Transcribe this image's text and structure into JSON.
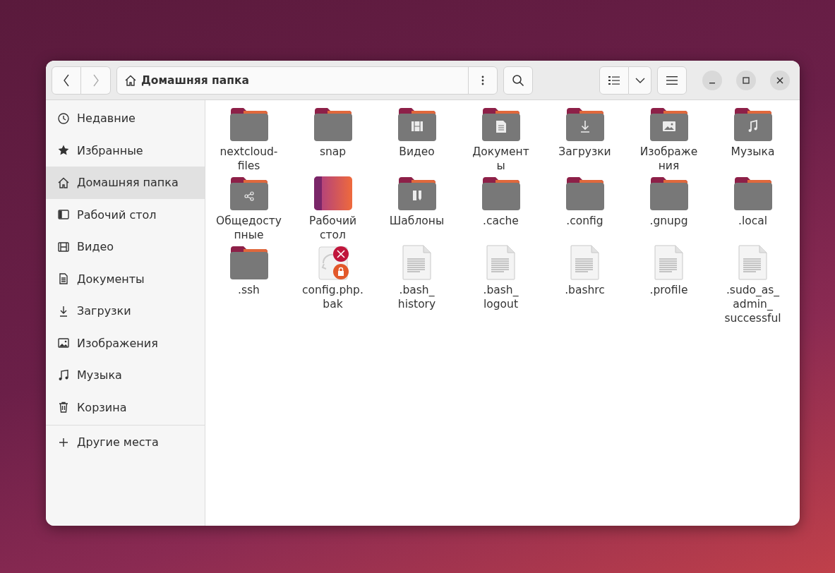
{
  "window": {
    "title": "Домашняя папка"
  },
  "sidebar": {
    "items": [
      {
        "kind": "recent",
        "label": "Недавние",
        "selected": false
      },
      {
        "kind": "starred",
        "label": "Избранные",
        "selected": false
      },
      {
        "kind": "home",
        "label": "Домашняя папка",
        "selected": true
      },
      {
        "kind": "desktop",
        "label": "Рабочий стол",
        "selected": false
      },
      {
        "kind": "video",
        "label": "Видео",
        "selected": false
      },
      {
        "kind": "document",
        "label": "Документы",
        "selected": false
      },
      {
        "kind": "download",
        "label": "Загрузки",
        "selected": false
      },
      {
        "kind": "image",
        "label": "Изображения",
        "selected": false
      },
      {
        "kind": "music",
        "label": "Музыка",
        "selected": false
      },
      {
        "kind": "trash",
        "label": "Корзина",
        "selected": false
      }
    ],
    "other": {
      "kind": "plus",
      "label": "Другие места"
    }
  },
  "files": [
    {
      "kind": "folder",
      "lines": [
        "nextcloud-",
        "files"
      ]
    },
    {
      "kind": "folder",
      "lines": [
        "snap"
      ]
    },
    {
      "kind": "video-folder",
      "lines": [
        "Видео"
      ]
    },
    {
      "kind": "document-folder",
      "lines": [
        "Документ",
        "ы"
      ]
    },
    {
      "kind": "download-folder",
      "lines": [
        "Загрузки"
      ]
    },
    {
      "kind": "image-folder",
      "lines": [
        "Изображе",
        "ния"
      ]
    },
    {
      "kind": "music-folder",
      "lines": [
        "Музыка"
      ]
    },
    {
      "kind": "share-folder",
      "lines": [
        "Общедосту",
        "пные"
      ]
    },
    {
      "kind": "desktop",
      "lines": [
        "Рабочий",
        "стол"
      ]
    },
    {
      "kind": "template-folder",
      "lines": [
        "Шаблоны"
      ]
    },
    {
      "kind": "folder",
      "lines": [
        ".cache"
      ]
    },
    {
      "kind": "folder",
      "lines": [
        ".config"
      ]
    },
    {
      "kind": "folder",
      "lines": [
        ".gnupg"
      ]
    },
    {
      "kind": "folder",
      "lines": [
        ".local"
      ]
    },
    {
      "kind": "folder",
      "lines": [
        ".ssh"
      ]
    },
    {
      "kind": "broken",
      "lines": [
        "config.php.",
        "bak"
      ]
    },
    {
      "kind": "text",
      "lines": [
        ".bash_",
        "history"
      ]
    },
    {
      "kind": "text",
      "lines": [
        ".bash_",
        "logout"
      ]
    },
    {
      "kind": "text",
      "lines": [
        ".bashrc"
      ]
    },
    {
      "kind": "text",
      "lines": [
        ".profile"
      ]
    },
    {
      "kind": "text",
      "lines": [
        ".sudo_as_",
        "admin_",
        "successful"
      ]
    }
  ]
}
